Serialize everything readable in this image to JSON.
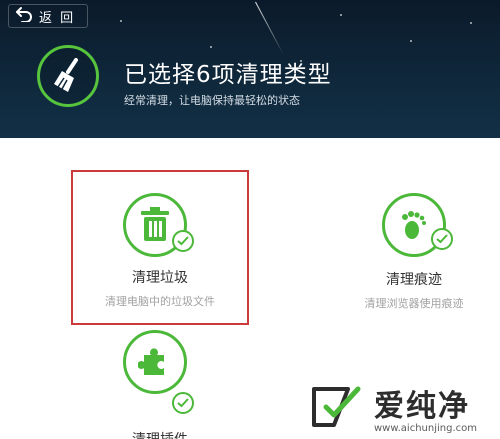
{
  "header": {
    "back_label": "返 回",
    "title": "已选择6项清理类型",
    "subtitle": "经常清理，让电脑保持最轻松的状态"
  },
  "cards": [
    {
      "name": "清理垃圾",
      "desc": "清理电脑中的垃圾文件",
      "icon": "trash-icon",
      "checked": true,
      "selected": true
    },
    {
      "name": "清理痕迹",
      "desc": "清理浏览器使用痕迹",
      "icon": "footprint-icon",
      "checked": true,
      "selected": false
    },
    {
      "name": "清理插件",
      "desc": "",
      "icon": "puzzle-icon",
      "checked": true,
      "selected": false
    }
  ],
  "watermark": {
    "text": "爱纯净",
    "url": "www.aichunjing.com"
  },
  "colors": {
    "accent_green": "#4cb83a",
    "selection_red": "#cc3b3b",
    "header_bg": "#0e2537"
  }
}
